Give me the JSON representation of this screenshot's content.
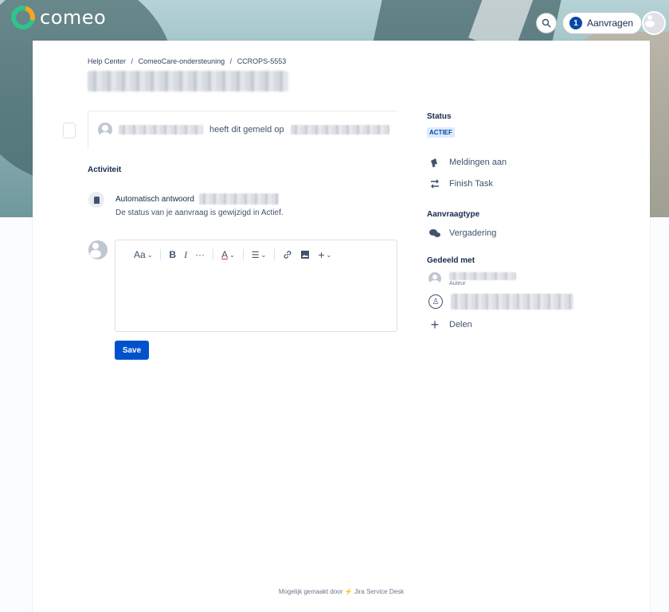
{
  "header": {
    "logo_text": "comeo",
    "requests_count": "1",
    "requests_label": "Aanvragen"
  },
  "breadcrumb": [
    "Help Center",
    "ComeoCare-ondersteuning",
    "CCROPS-5553"
  ],
  "breadcrumb_sep": "/",
  "reporter": {
    "text": "heeft dit gemeld op"
  },
  "activity": {
    "heading": "Activiteit",
    "auto_title": "Automatisch antwoord",
    "auto_text": "De status van je aanvraag is gewijzigd in Actief."
  },
  "editor": {
    "toolbar": {
      "text_style": "Aa",
      "bold": "B",
      "italic": "I",
      "more": "···",
      "text_color": "A",
      "list": "☰",
      "link": "🔗",
      "image": "▣",
      "insert": "+"
    },
    "save_label": "Save"
  },
  "sidebar": {
    "status_label": "Status",
    "status_value": "ACTIEF",
    "notifications": "Meldingen aan",
    "finish_task": "Finish Task",
    "request_type_label": "Aanvraagtype",
    "request_type_value": "Vergadering",
    "shared_label": "Gedeeld met",
    "author_role": "Auteur",
    "share_action": "Delen"
  },
  "footer": {
    "prefix": "Mogelijk gemaakt door",
    "product": "Jira Service Desk"
  },
  "colors": {
    "primary": "#0052cc",
    "badge_bg": "#deebff",
    "badge_text": "#0747a6",
    "logo_green": "#2ec48c",
    "logo_orange": "#f5a623"
  },
  "icons": {
    "search": "search-icon",
    "notifications": "megaphone-icon",
    "finish_task": "transition-arrows-icon",
    "request_type": "chat-bubbles-icon",
    "share": "plus-icon",
    "group": "people-icon",
    "footer": "jira-bolt-icon"
  }
}
